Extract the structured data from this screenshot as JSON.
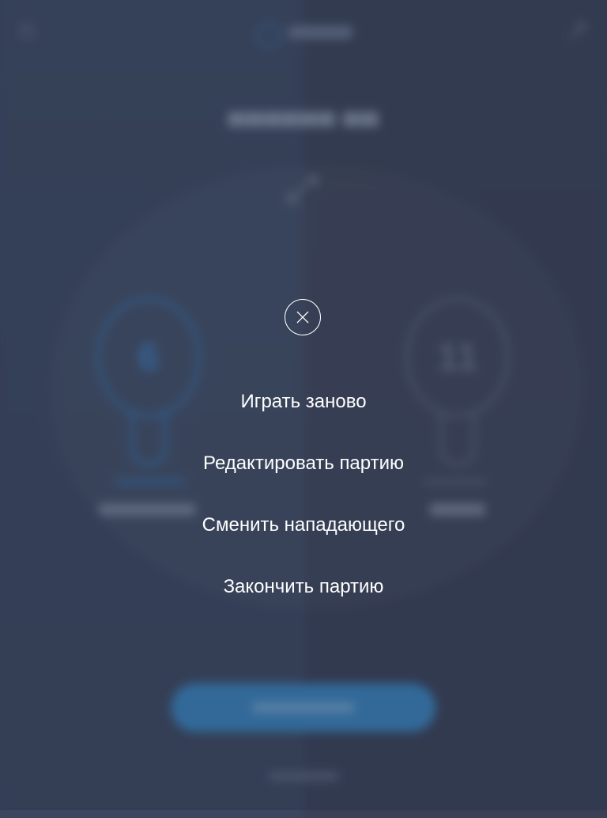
{
  "overlay": {
    "close_icon": "close-icon",
    "menu": [
      {
        "id": "restart",
        "label": "Играть заново"
      },
      {
        "id": "edit",
        "label": "Редактировать партию"
      },
      {
        "id": "switch-server",
        "label": "Сменить нападающего"
      },
      {
        "id": "finish",
        "label": "Закончить партию"
      }
    ]
  },
  "background": {
    "scores": {
      "left": "6",
      "right": "11"
    }
  },
  "colors": {
    "overlay_text": "#ffffff",
    "accent_blue": "#3a88c6",
    "bg_left": "#3e4a63",
    "bg_right": "#3b4156"
  }
}
